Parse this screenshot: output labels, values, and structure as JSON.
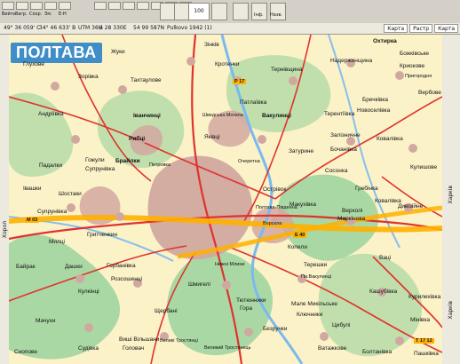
{
  "toolbar": {
    "buttons": [
      {
        "label": "Вийти"
      },
      {
        "label": "Загр."
      },
      {
        "label": "Сохр."
      },
      {
        "label": "Зм."
      },
      {
        "label": "Е-Н"
      },
      {
        "label": "Інф."
      },
      {
        "label": "Назв."
      }
    ],
    "zoom_value": "100"
  },
  "status": {
    "lat": "49° 36 059' С",
    "lon": "34° 46 633' В",
    "utm": "UTM 36U",
    "x": "6 28 330E",
    "y": "54 99 587N",
    "datum": "Pulkovo 1942 (1)"
  },
  "tabs": [
    {
      "label": "Карта"
    },
    {
      "label": "Растр"
    },
    {
      "label": "Карта"
    }
  ],
  "rails": {
    "left": "Хорол",
    "right_top": "Харків",
    "right_bottom": "Харків"
  },
  "map": {
    "title": "ПОЛТАВА",
    "places": [
      {
        "name": "Глухове"
      },
      {
        "name": "Жуки"
      },
      {
        "name": "Зінків"
      },
      {
        "name": "Кротенки"
      },
      {
        "name": "Тернівщина"
      },
      {
        "name": "Надержинщина"
      },
      {
        "name": "Охтирка"
      },
      {
        "name": "Божківське"
      },
      {
        "name": "Зорівка"
      },
      {
        "name": "Тахтаулове"
      },
      {
        "name": "Криокове"
      },
      {
        "name": "Пригородня"
      },
      {
        "name": "Андріївка"
      },
      {
        "name": "Іванчинці"
      },
      {
        "name": "Патлаївка"
      },
      {
        "name": "Вакулинці"
      },
      {
        "name": "Бречківка"
      },
      {
        "name": "Вербове"
      },
      {
        "name": "Шведська Могила"
      },
      {
        "name": "Терентіївка"
      },
      {
        "name": "Новоселівка"
      },
      {
        "name": "Рибці"
      },
      {
        "name": "Яківці"
      },
      {
        "name": "Залізничне"
      },
      {
        "name": "Ковалівка"
      },
      {
        "name": "Брайлки"
      },
      {
        "name": "Петровка"
      },
      {
        "name": "Затурине"
      },
      {
        "name": "Бочанівка"
      },
      {
        "name": "Падалки"
      },
      {
        "name": "Гожули"
      },
      {
        "name": "Супрунівка"
      },
      {
        "name": "Очеретна"
      },
      {
        "name": "Сосонка"
      },
      {
        "name": "Кулишове"
      },
      {
        "name": "Івашки"
      },
      {
        "name": "Шостаки"
      },
      {
        "name": "Острівок"
      },
      {
        "name": "Гребінка"
      },
      {
        "name": "Макухівка"
      },
      {
        "name": "Ковалівка"
      },
      {
        "name": "Супрунівка"
      },
      {
        "name": "Полтава-Південна"
      },
      {
        "name": "Верхолі"
      },
      {
        "name": "Дивізійне"
      },
      {
        "name": "Милці"
      },
      {
        "name": "Гритченкин"
      },
      {
        "name": "Ворскла"
      },
      {
        "name": "Маркінова"
      },
      {
        "name": "Копили"
      },
      {
        "name": "Байрак"
      },
      {
        "name": "Дашки"
      },
      {
        "name": "Горбанівка"
      },
      {
        "name": "Нижні Млини"
      },
      {
        "name": "Розсошенці"
      },
      {
        "name": "Терешки"
      },
      {
        "name": "Пи.Вакулинці"
      },
      {
        "name": "Ваці"
      },
      {
        "name": "Кулкінці"
      },
      {
        "name": "Шмигелі"
      },
      {
        "name": "Тютюнники"
      },
      {
        "name": "Кашубівка"
      },
      {
        "name": "Курилехівка"
      },
      {
        "name": "Мачухи"
      },
      {
        "name": "Щербані"
      },
      {
        "name": "Гора"
      },
      {
        "name": "Мале Микільське"
      },
      {
        "name": "Ключники"
      },
      {
        "name": "Вишi Вільшани"
      },
      {
        "name": "Безручки"
      },
      {
        "name": "Цибулі"
      },
      {
        "name": "Великі Тростянці"
      },
      {
        "name": "Мінівка"
      },
      {
        "name": "Пашківка"
      },
      {
        "name": "Снопове"
      },
      {
        "name": "Судівка"
      },
      {
        "name": "Головач"
      },
      {
        "name": "Ватажкове"
      },
      {
        "name": "Болтанівка"
      },
      {
        "name": "Великий Тростянець"
      }
    ],
    "route_markers": [
      {
        "label": "М 03"
      },
      {
        "label": "Р 17"
      },
      {
        "label": "Е 40"
      },
      {
        "label": "Т 17 12"
      }
    ],
    "colors": {
      "background": "#fbf2c8",
      "forest": "#8fcf98",
      "urban": "#d1a8a0",
      "road": "#e0322d",
      "highway": "#ffb000",
      "water": "#79b9ef",
      "title_bg": "#3f8ec8"
    }
  }
}
